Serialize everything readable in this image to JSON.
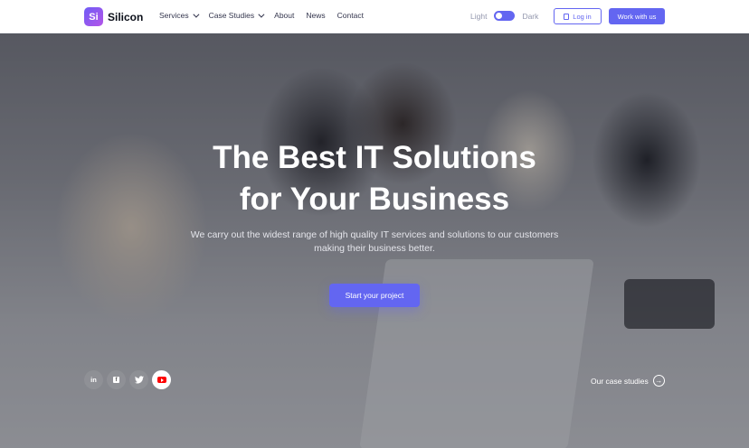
{
  "brand": {
    "logo_mark": "Si",
    "name": "Silicon",
    "accent_color": "#6366f1"
  },
  "nav": {
    "items": [
      {
        "label": "Services",
        "has_dropdown": true
      },
      {
        "label": "Case Studies",
        "has_dropdown": true
      },
      {
        "label": "About",
        "has_dropdown": false
      },
      {
        "label": "News",
        "has_dropdown": false
      },
      {
        "label": "Contact",
        "has_dropdown": false
      }
    ]
  },
  "theme_toggle": {
    "light_label": "Light",
    "dark_label": "Dark"
  },
  "header_buttons": {
    "login_label": "Log in",
    "work_label": "Work with us"
  },
  "hero": {
    "title_line1": "The Best IT Solutions",
    "title_line2": "for Your Business",
    "subtitle": "We carry out the widest range of high quality IT services and solutions to our customers making their business better.",
    "cta_label": "Start your project",
    "case_link_label": "Our case studies"
  },
  "socials": [
    {
      "name": "linkedin-icon",
      "glyph": "in"
    },
    {
      "name": "facebook-icon",
      "glyph": "f"
    },
    {
      "name": "twitter-icon",
      "glyph": "🐦"
    },
    {
      "name": "youtube-icon",
      "glyph": "▶"
    }
  ]
}
